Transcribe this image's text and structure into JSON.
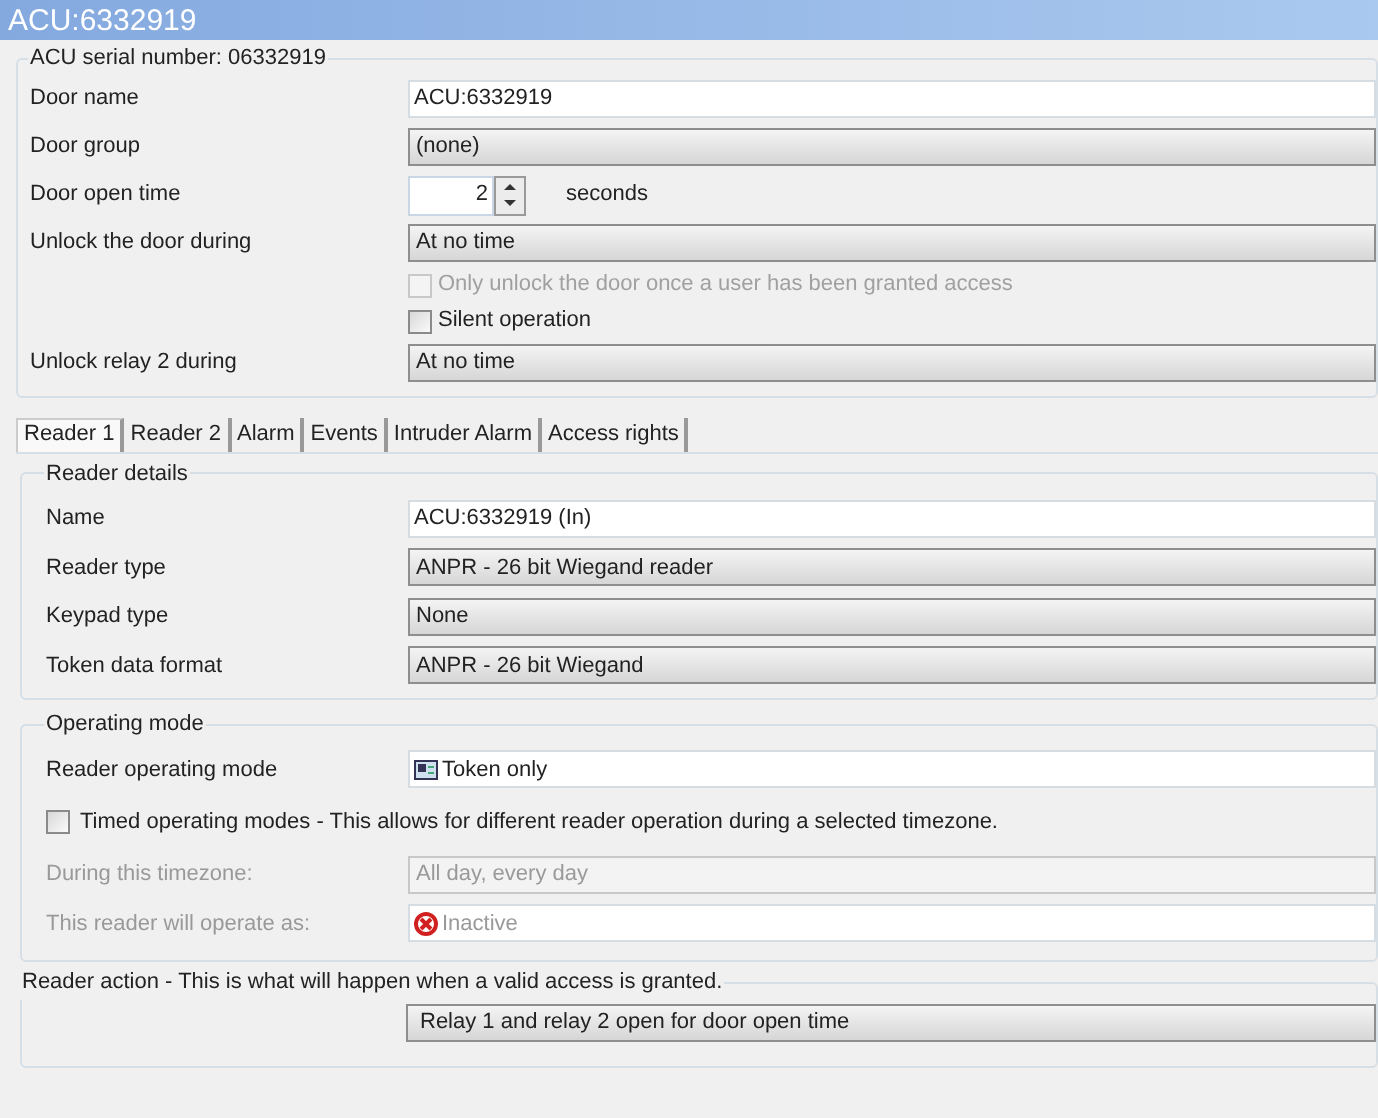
{
  "window": {
    "title": "ACU:6332919"
  },
  "door": {
    "title": "ACU serial number: 06332919",
    "fields": [
      {
        "kind": "text",
        "label": "Door name",
        "value": "ACU:6332919"
      },
      {
        "kind": "dropdown",
        "label": "Door group",
        "value": "(none)"
      },
      {
        "kind": "spinner",
        "label": "Door open time",
        "value": "2",
        "unit": "seconds"
      },
      {
        "kind": "dropdown",
        "label": "Unlock the door during",
        "value": "At no time"
      },
      {
        "kind": "checkbox",
        "label": "Only unlock the door once a user has been granted access",
        "checked": false,
        "disabled": true
      },
      {
        "kind": "checkbox",
        "label": "Silent operation",
        "checked": false,
        "disabled": false
      },
      {
        "kind": "dropdown",
        "label": "Unlock relay 2 during",
        "value": "At no time"
      }
    ]
  },
  "tabs": [
    {
      "label": "Reader 1",
      "selected": true
    },
    {
      "label": "Reader 2",
      "selected": false
    },
    {
      "label": "Alarm",
      "selected": false
    },
    {
      "label": "Events",
      "selected": false
    },
    {
      "label": "Intruder Alarm",
      "selected": false
    },
    {
      "label": "Access rights",
      "selected": false
    }
  ],
  "reader_details": {
    "title": "Reader details",
    "fields": [
      {
        "kind": "text",
        "label": "Name",
        "value": "ACU:6332919 (In)"
      },
      {
        "kind": "dropdown",
        "label": "Reader type",
        "value": "ANPR - 26 bit Wiegand reader"
      },
      {
        "kind": "dropdown",
        "label": "Keypad type",
        "value": "None"
      },
      {
        "kind": "dropdown",
        "label": "Token data format",
        "value": "ANPR - 26 bit Wiegand"
      }
    ]
  },
  "operating_mode": {
    "title": "Operating mode",
    "fields": [
      {
        "kind": "card",
        "label": "Reader operating mode",
        "value": "Token only",
        "disabled": false
      },
      {
        "kind": "checkbox",
        "label": "Timed operating modes - This allows for different reader operation during a selected timezone.",
        "checked": false,
        "disabled": false
      },
      {
        "kind": "dropdown",
        "label": "During this timezone:",
        "value": "All day, every day",
        "disabled": true
      },
      {
        "kind": "inactive",
        "label": "This reader will operate as:",
        "value": "Inactive",
        "disabled": true
      }
    ]
  },
  "reader_action": {
    "title": "Reader action - This is what will happen when a valid access is granted.",
    "value": "Relay 1 and relay 2 open for door open time"
  }
}
